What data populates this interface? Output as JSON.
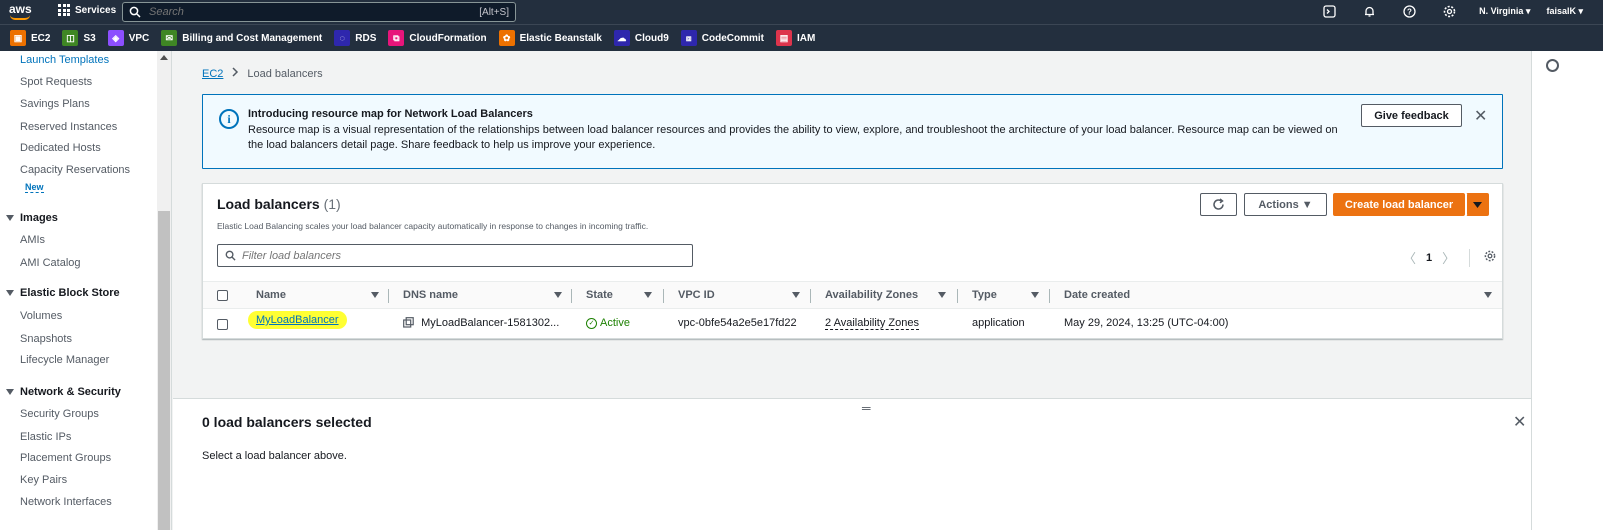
{
  "topbar": {
    "logo": "aws",
    "services_label": "Services",
    "search_placeholder": "Search",
    "search_shortcut": "[Alt+S]",
    "region": "N. Virginia ▾",
    "account": "faisalK ▾",
    "icons": [
      "cloudshell-icon",
      "bell-icon",
      "help-icon",
      "gear-icon"
    ]
  },
  "favorites": [
    {
      "label": "EC2",
      "color": "#ed7100",
      "glyph": "▣"
    },
    {
      "label": "S3",
      "color": "#3f8624",
      "glyph": "◫"
    },
    {
      "label": "VPC",
      "color": "#8c4fff",
      "glyph": "◈"
    },
    {
      "label": "Billing and Cost Management",
      "color": "#3f8624",
      "glyph": "✉"
    },
    {
      "label": "RDS",
      "color": "#2e27ad",
      "glyph": "◌"
    },
    {
      "label": "CloudFormation",
      "color": "#e7157b",
      "glyph": "⧉"
    },
    {
      "label": "Elastic Beanstalk",
      "color": "#ed7100",
      "glyph": "✿"
    },
    {
      "label": "Cloud9",
      "color": "#2e27ad",
      "glyph": "☁"
    },
    {
      "label": "CodeCommit",
      "color": "#2e27ad",
      "glyph": "⧈"
    },
    {
      "label": "IAM",
      "color": "#dd344c",
      "glyph": "▤"
    }
  ],
  "sidebar": {
    "items_top": [
      "Launch Templates",
      "Spot Requests",
      "Savings Plans",
      "Reserved Instances",
      "Dedicated Hosts",
      "Capacity Reservations"
    ],
    "new_badge": "New",
    "images": {
      "title": "Images",
      "items": [
        "AMIs",
        "AMI Catalog"
      ]
    },
    "ebs": {
      "title": "Elastic Block Store",
      "items": [
        "Volumes",
        "Snapshots",
        "Lifecycle Manager"
      ]
    },
    "network": {
      "title": "Network & Security",
      "items": [
        "Security Groups",
        "Elastic IPs",
        "Placement Groups",
        "Key Pairs",
        "Network Interfaces"
      ]
    }
  },
  "breadcrumb": {
    "root": "EC2",
    "separator": ">",
    "current": "Load balancers"
  },
  "flash": {
    "title": "Introducing resource map for Network Load Balancers",
    "body": "Resource map is a visual representation of the relationships between load balancer resources and provides the ability to view, explore, and troubleshoot the architecture of your load balancer. Resource map can be viewed on the load balancers detail page. Share feedback to help us improve your experience.",
    "feedback_button": "Give feedback"
  },
  "panel": {
    "title": "Load balancers",
    "count": "(1)",
    "description": "Elastic Load Balancing scales your load balancer capacity automatically in response to changes in incoming traffic.",
    "actions_button": "Actions ▼",
    "create_button": "Create load balancer",
    "filter_placeholder": "Filter load balancers",
    "page": "1"
  },
  "table": {
    "columns": [
      "Name",
      "DNS name",
      "State",
      "VPC ID",
      "Availability Zones",
      "Type",
      "Date created"
    ],
    "rows": [
      {
        "name": "MyLoadBalancer",
        "dns": "MyLoadBalancer-1581302...",
        "state": "Active",
        "vpc": "vpc-0bfe54a2e5e17fd22",
        "az": "2 Availability Zones",
        "type": "application",
        "date": "May 29, 2024, 13:25 (UTC-04:00)"
      }
    ]
  },
  "split_panel": {
    "title": "0 load balancers selected",
    "text": "Select a load balancer above."
  },
  "colors": {
    "accent": "#0073bb",
    "primary": "#ec7211",
    "nav": "#232f3e",
    "highlight": "#ffff33",
    "success": "#1d8102"
  }
}
